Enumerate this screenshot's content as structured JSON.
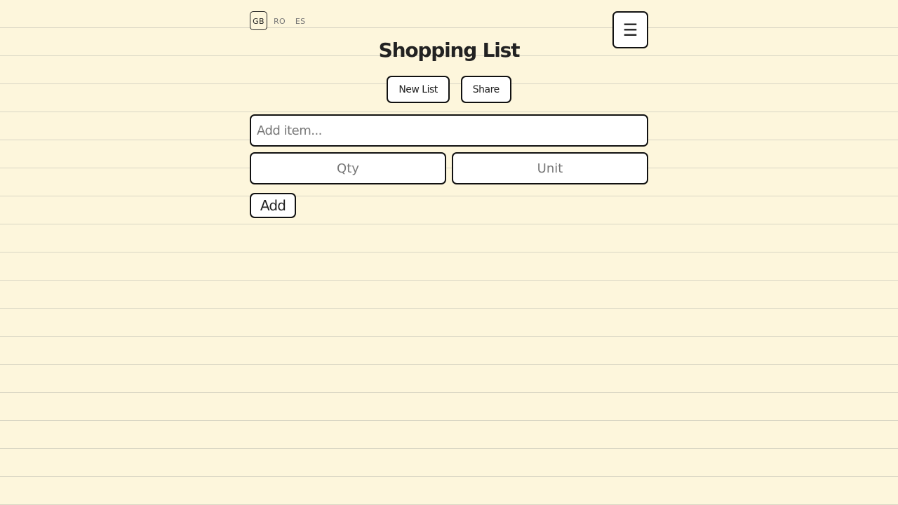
{
  "languages": {
    "items": [
      "GB",
      "RO",
      "ES"
    ],
    "selected": "GB"
  },
  "menu": {
    "icon": "hamburger-menu-icon",
    "glyph": "☰"
  },
  "header": {
    "title": "Shopping List"
  },
  "actions": {
    "new_list_label": "New List",
    "share_label": "Share"
  },
  "form": {
    "item_placeholder": "Add item...",
    "item_value": "",
    "qty_placeholder": "Qty",
    "qty_value": "",
    "unit_placeholder": "Unit",
    "unit_value": "",
    "add_label": "Add"
  },
  "colors": {
    "background": "#fdf6dc",
    "ruled_line": "#d9d6c4",
    "border": "#111111",
    "text": "#222222"
  }
}
